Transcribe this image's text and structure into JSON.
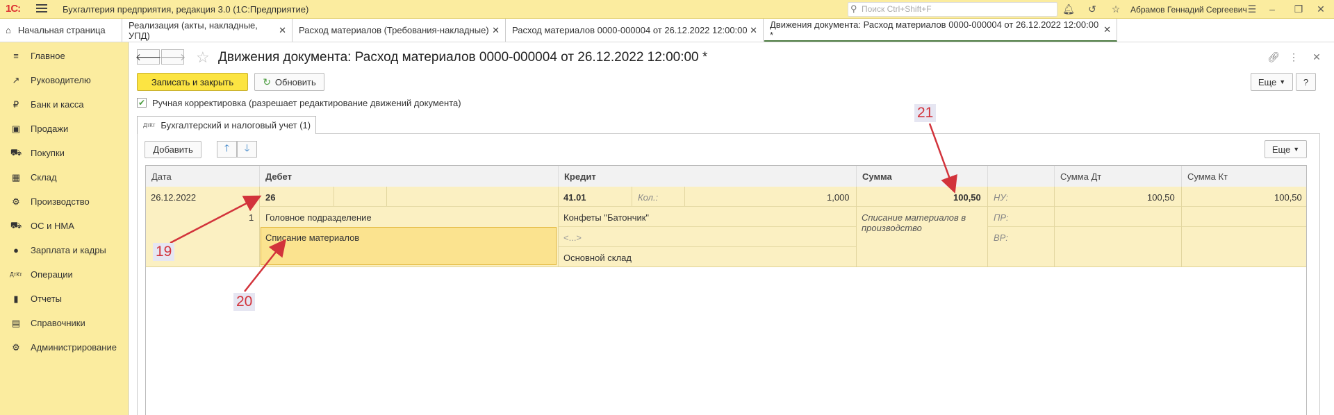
{
  "titlebar": {
    "logo": "1С:",
    "app_title": "Бухгалтерия предприятия, редакция 3.0  (1С:Предприятие)",
    "search_placeholder": "Поиск Ctrl+Shift+F",
    "user_name": "Абрамов Геннадий Сергеевич"
  },
  "tabs": [
    {
      "label": "Начальная страница"
    },
    {
      "label": "Реализация (акты, накладные, УПД)"
    },
    {
      "label": "Расход материалов (Требования-накладные)"
    },
    {
      "label": "Расход материалов 0000-000004 от 26.12.2022 12:00:00"
    },
    {
      "label": "Движения документа: Расход материалов 0000-000004 от 26.12.2022 12:00:00 *"
    }
  ],
  "sidebar": {
    "items": [
      {
        "label": "Главное",
        "icon": "≡"
      },
      {
        "label": "Руководителю",
        "icon": "↗"
      },
      {
        "label": "Банк и касса",
        "icon": "₽"
      },
      {
        "label": "Продажи",
        "icon": "▣"
      },
      {
        "label": "Покупки",
        "icon": "⛟"
      },
      {
        "label": "Склад",
        "icon": "▦"
      },
      {
        "label": "Производство",
        "icon": "⚙"
      },
      {
        "label": "ОС и НМА",
        "icon": "⛟"
      },
      {
        "label": "Зарплата и кадры",
        "icon": "●"
      },
      {
        "label": "Операции",
        "icon": "ДтКт"
      },
      {
        "label": "Отчеты",
        "icon": "▮"
      },
      {
        "label": "Справочники",
        "icon": "▤"
      },
      {
        "label": "Администрирование",
        "icon": "⚙"
      }
    ]
  },
  "doc": {
    "title": "Движения документа: Расход материалов 0000-000004 от 26.12.2022 12:00:00 *",
    "save_label": "Записать и закрыть",
    "refresh_label": "Обновить",
    "more_label": "Еще",
    "help_label": "?",
    "checkbox_label": "Ручная корректировка (разрешает редактирование движений документа)",
    "subtab_icon": "ДтКт",
    "subtab_label": "Бухгалтерский и налоговый учет (1)",
    "add_label": "Добавить",
    "panel_more_label": "Еще"
  },
  "table": {
    "headers": {
      "date": "Дата",
      "debit": "Дебет",
      "credit": "Кредит",
      "sum": "Сумма",
      "sum_dt": "Сумма Дт",
      "sum_kt": "Сумма Кт"
    },
    "row": {
      "date": "26.12.2022",
      "line_no": "1",
      "debit_account": "26",
      "debit_subconto1": "Головное подразделение",
      "debit_subconto2": "Списание материалов",
      "credit_account": "41.01",
      "qty_label": "Кол.:",
      "qty_value": "1,000",
      "credit_subconto1": "Конфеты \"Батончик\"",
      "credit_subconto2": "<...>",
      "credit_subconto3": "Основной склад",
      "sum": "100,50",
      "sum_comment": "Списание материалов в производство",
      "nu_label": "НУ:",
      "pr_label": "ПР:",
      "vr_label": "ВР:",
      "sum_dt": "100,50",
      "sum_kt": "100,50"
    }
  },
  "annotations": [
    {
      "label": "19"
    },
    {
      "label": "20"
    },
    {
      "label": "21"
    }
  ],
  "colors": {
    "sidebar_bg": "#fbec9f",
    "primary_button": "#fce442",
    "row_highlight": "#fbf0c2",
    "selected_cell": "#fbe38f",
    "annotation": "#d2333b"
  }
}
